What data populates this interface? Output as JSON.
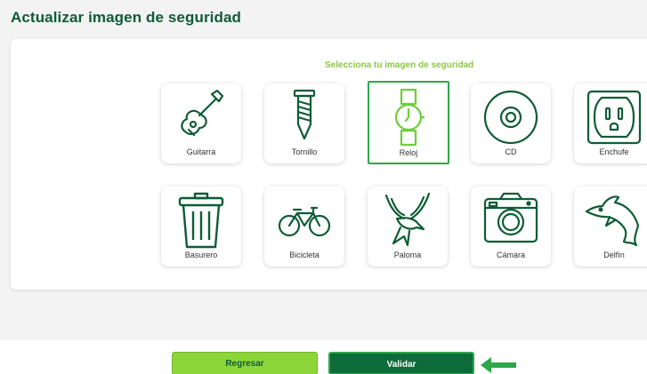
{
  "header": {
    "title": "Actualizar imagen de seguridad"
  },
  "selector": {
    "subtitle": "Selecciona tu imagen de seguridad",
    "options": [
      {
        "label": "Guitarra",
        "icon": "guitar-icon",
        "selected": false
      },
      {
        "label": "Tornillo",
        "icon": "screw-icon",
        "selected": false
      },
      {
        "label": "Reloj",
        "icon": "watch-icon",
        "selected": true
      },
      {
        "label": "CD",
        "icon": "cd-icon",
        "selected": false
      },
      {
        "label": "Enchufe",
        "icon": "outlet-icon",
        "selected": false
      },
      {
        "label": "Basurero",
        "icon": "trash-icon",
        "selected": false
      },
      {
        "label": "Bicicleta",
        "icon": "bicycle-icon",
        "selected": false
      },
      {
        "label": "Paloma",
        "icon": "dove-icon",
        "selected": false
      },
      {
        "label": "Cámara",
        "icon": "camera-icon",
        "selected": false
      },
      {
        "label": "Delfín",
        "icon": "dolphin-icon",
        "selected": false
      }
    ]
  },
  "actions": {
    "back_label": "Regresar",
    "validate_label": "Validar"
  },
  "colors": {
    "brand_dark": "#0e5c36",
    "accent_light": "#8dd63a",
    "selected_border": "#2ba84a",
    "subtitle": "#8dc63f"
  }
}
